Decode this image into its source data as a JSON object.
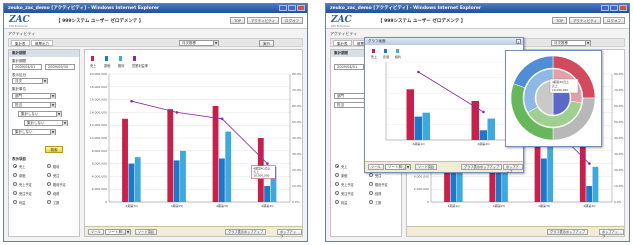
{
  "window": {
    "title": "zeuko_zac_demo [アクティビティ] - Windows Internet Explorer",
    "logo": "ZAC",
    "logo_sub": "ZAC Enterprise",
    "system_title": "【 999システム ユーザー ゼロデメンテ 】",
    "header_buttons": [
      "TOP",
      "アクティビティ",
      "ログオフ"
    ]
  },
  "page": {
    "title": "アクティビティ",
    "tabs": [
      "集計表",
      "帳票出力"
    ],
    "tab_dropdown": "月次推移",
    "tab_button": "実行"
  },
  "sidebar": {
    "header": "集計期間",
    "fields": [
      {
        "label": "集計期間",
        "value": "2009/04/01"
      },
      {
        "label": "",
        "value": "2009/09/30"
      },
      {
        "label": "表示区分",
        "value": "月次"
      },
      {
        "label": "集計単位",
        "value": "部門"
      },
      {
        "label": "",
        "value": "担当"
      },
      {
        "label": "",
        "value": "集計しない"
      },
      {
        "label": "",
        "value": "集計しない"
      },
      {
        "label": "",
        "value": "集計しない"
      }
    ],
    "run_button": "検索",
    "item_header": "表示項目",
    "radio_items": [
      "売上",
      "粗利",
      "原価",
      "受注",
      "売上予定",
      "粗利予定",
      "受注予定",
      "経費",
      "利益",
      "工数"
    ],
    "radio_selected": 0
  },
  "chart_data": {
    "type": "bar",
    "legend": [
      "売上",
      "原価",
      "粗利",
      "営業利益率"
    ],
    "colors": {
      "sales": "#c8204d",
      "cost": "#1e78c8",
      "profit": "#3fa8dc",
      "line": "#8a2a9c"
    },
    "categories": [
      "4期第1Q",
      "4期第2Q",
      "4期第3Q",
      "4期第4Q"
    ],
    "ylim": [
      0,
      20000000
    ],
    "y2lim": [
      0,
      80
    ],
    "yticks": [
      "20,000,000",
      "18,000,000",
      "16,000,000",
      "14,000,000",
      "12,000,000",
      "10,000,000",
      "8,000,000",
      "6,000,000",
      "4,000,000",
      "2,000,000",
      "0"
    ],
    "y2ticks": [
      "80.0%",
      "70.0%",
      "60.0%",
      "50.0%",
      "40.0%",
      "30.0%",
      "20.0%",
      "10.0%",
      "0.0%"
    ],
    "series": [
      {
        "name": "売上",
        "values": [
          13000000,
          14500000,
          15000000,
          10000000
        ]
      },
      {
        "name": "原価",
        "values": [
          6000000,
          6500000,
          6800000,
          2500000
        ]
      },
      {
        "name": "粗利",
        "values": [
          7000000,
          8000000,
          11000000,
          5500000
        ]
      },
      {
        "name": "営業利益率",
        "values": [
          63.0,
          56.0,
          52.0,
          24.0
        ]
      }
    ],
    "tooltip": {
      "title": "4期第4Q売上",
      "label": "売上",
      "value": "10,000,000"
    }
  },
  "bottom_bar": {
    "label": "ツール",
    "dropdown": "ソート無し",
    "label2": "ソート項目",
    "buttons": [
      "グラフ表示ポップアップ",
      "ポップアップ"
    ]
  },
  "popup": {
    "title": "グラフ画面",
    "legend": [
      "売上",
      "原価",
      "粗利"
    ],
    "tooltip": "4期第4Q売上",
    "pie_tooltip": {
      "title": "4期第4Q売上",
      "label": "売上",
      "value": "10,000,000"
    }
  }
}
